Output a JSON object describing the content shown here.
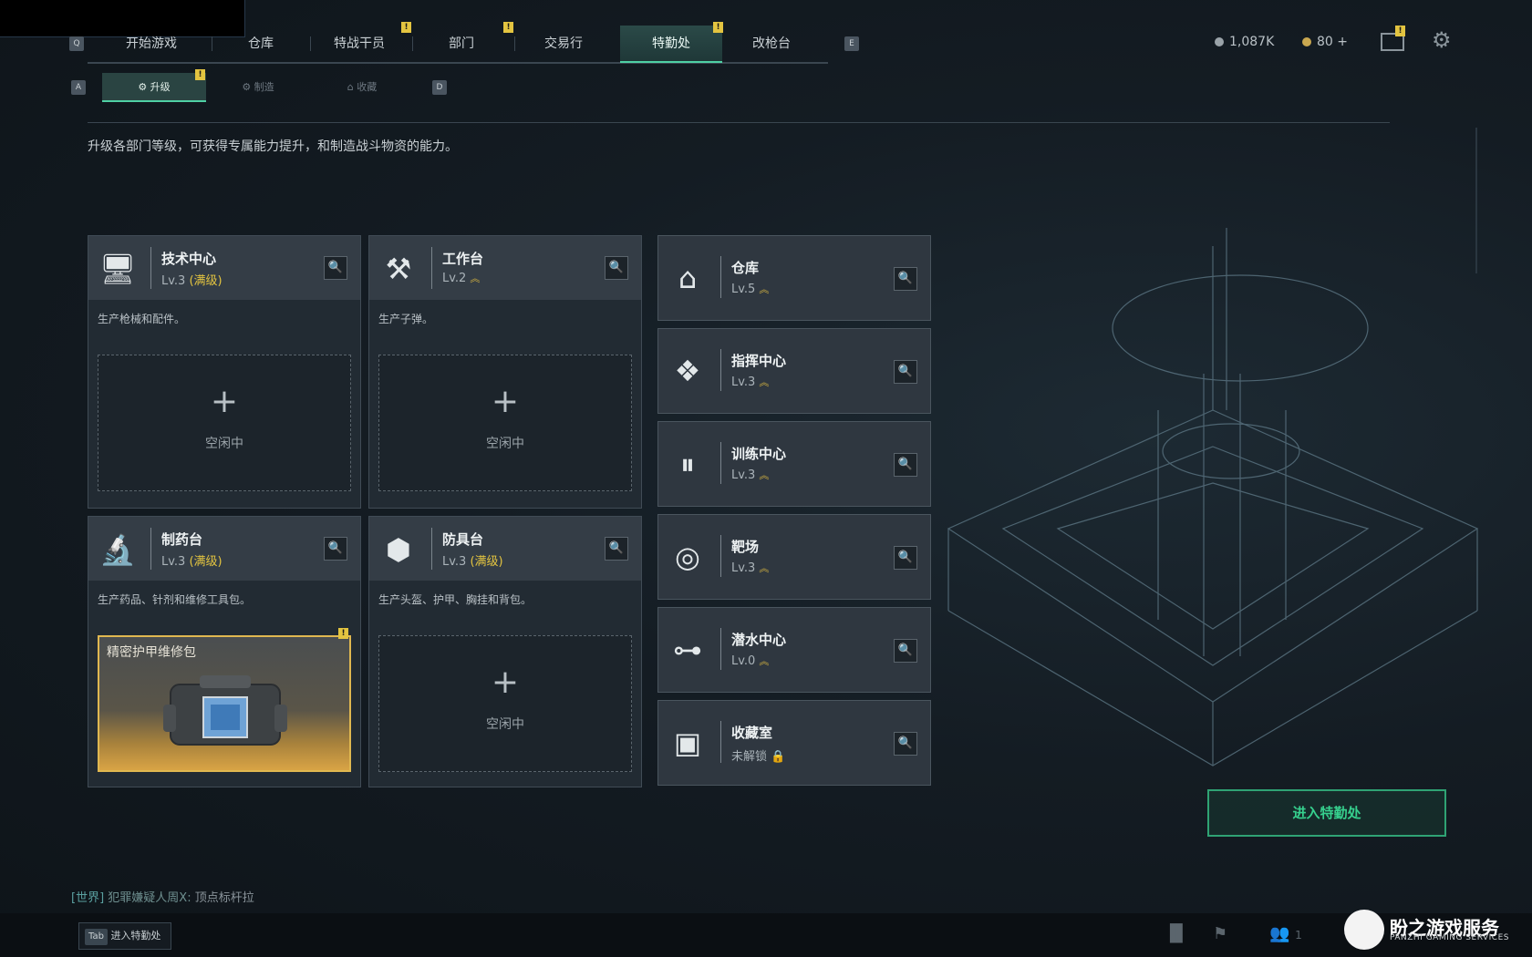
{
  "top_nav": {
    "key_left": "Q",
    "key_right": "E",
    "tabs": [
      {
        "label": "开始游戏",
        "badge": ""
      },
      {
        "label": "仓库",
        "badge": ""
      },
      {
        "label": "特战干员",
        "badge": "!"
      },
      {
        "label": "部门",
        "badge": "!"
      },
      {
        "label": "交易行",
        "badge": ""
      },
      {
        "label": "特勤处",
        "badge": "!",
        "active": true
      },
      {
        "label": "改枪台",
        "badge": ""
      }
    ]
  },
  "currency": {
    "coins": "1,087K",
    "premium": "80"
  },
  "sub_tabs": {
    "key_left": "A",
    "key_right": "D",
    "items": [
      {
        "label": "升级",
        "active": true,
        "badge": "!"
      },
      {
        "label": "制造"
      },
      {
        "label": "收藏"
      }
    ]
  },
  "description": "升级各部门等级，可获得专属能力提升，和制造战斗物资的能力。",
  "stations": [
    {
      "name": "技术中心",
      "level": "Lv.3",
      "max": "(满级)",
      "subtitle": "生产枪械和配件。",
      "slot": "空闲中",
      "icon": "monitor-icon"
    },
    {
      "name": "工作台",
      "level": "Lv.2",
      "subtitle": "生产子弹。",
      "slot": "空闲中",
      "icon": "tools-icon"
    },
    {
      "name": "制药台",
      "level": "Lv.3",
      "max": "(满级)",
      "subtitle": "生产药品、针剂和维修工具包。",
      "crafting": "精密护甲维修包",
      "icon": "microscope-icon"
    },
    {
      "name": "防具台",
      "level": "Lv.3",
      "max": "(满级)",
      "subtitle": "生产头盔、护甲、胸挂和背包。",
      "slot": "空闲中",
      "icon": "cubes-icon"
    }
  ],
  "departments": [
    {
      "name": "仓库",
      "level": "Lv.5",
      "icon": "warehouse-icon"
    },
    {
      "name": "指挥中心",
      "level": "Lv.3",
      "icon": "command-icon"
    },
    {
      "name": "训练中心",
      "level": "Lv.3",
      "icon": "dumbbell-icon"
    },
    {
      "name": "靶场",
      "level": "Lv.3",
      "icon": "target-icon"
    },
    {
      "name": "潜水中心",
      "level": "Lv.0",
      "icon": "diving-mask-icon"
    },
    {
      "name": "收藏室",
      "level": "未解锁",
      "icon": "vault-icon",
      "locked": true
    }
  ],
  "enter_button": "进入特勤处",
  "chat": {
    "channel": "[世界]",
    "sender": "犯罪嫌疑人周X:",
    "message": "顶点标杆拉"
  },
  "tab_hint": {
    "key": "Tab",
    "label": "进入特勤处"
  },
  "watermark": {
    "main": "盼之游戏服务",
    "sub": "PANZHI GAMING SERVICES"
  },
  "friends_count": "1"
}
